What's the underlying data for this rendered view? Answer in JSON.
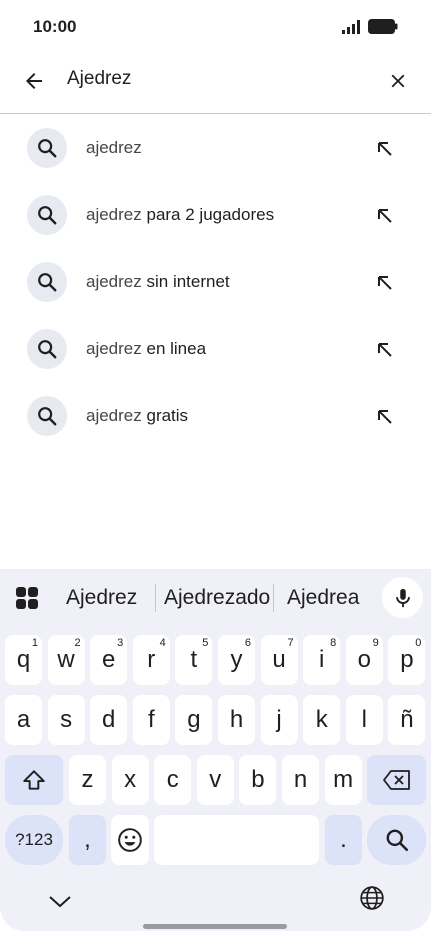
{
  "status_bar": {
    "time": "10:00"
  },
  "search": {
    "query": "Ajedrez"
  },
  "suggestions": [
    {
      "prefix": "ajedrez",
      "suffix": ""
    },
    {
      "prefix": "ajedrez",
      "suffix": " para 2 jugadores"
    },
    {
      "prefix": "ajedrez",
      "suffix": " sin internet"
    },
    {
      "prefix": "ajedrez",
      "suffix": " en linea"
    },
    {
      "prefix": "ajedrez",
      "suffix": " gratis"
    }
  ],
  "keyboard": {
    "word_suggestions": [
      "Ajedrez",
      "Ajedrezado",
      "Ajedrea"
    ],
    "row1": [
      {
        "k": "q",
        "h": "1"
      },
      {
        "k": "w",
        "h": "2"
      },
      {
        "k": "e",
        "h": "3"
      },
      {
        "k": "r",
        "h": "4"
      },
      {
        "k": "t",
        "h": "5"
      },
      {
        "k": "y",
        "h": "6"
      },
      {
        "k": "u",
        "h": "7"
      },
      {
        "k": "i",
        "h": "8"
      },
      {
        "k": "o",
        "h": "9"
      },
      {
        "k": "p",
        "h": "0"
      }
    ],
    "row2": [
      "a",
      "s",
      "d",
      "f",
      "g",
      "h",
      "j",
      "k",
      "l",
      "ñ"
    ],
    "row3": [
      "z",
      "x",
      "c",
      "v",
      "b",
      "n",
      "m"
    ],
    "symbols_label": "?123",
    "comma": ",",
    "period": "."
  },
  "colors": {
    "accent_bg": "#dce2f7",
    "keyboard_bg": "#f0f1f8",
    "icon_bg": "#e8eaf2"
  }
}
